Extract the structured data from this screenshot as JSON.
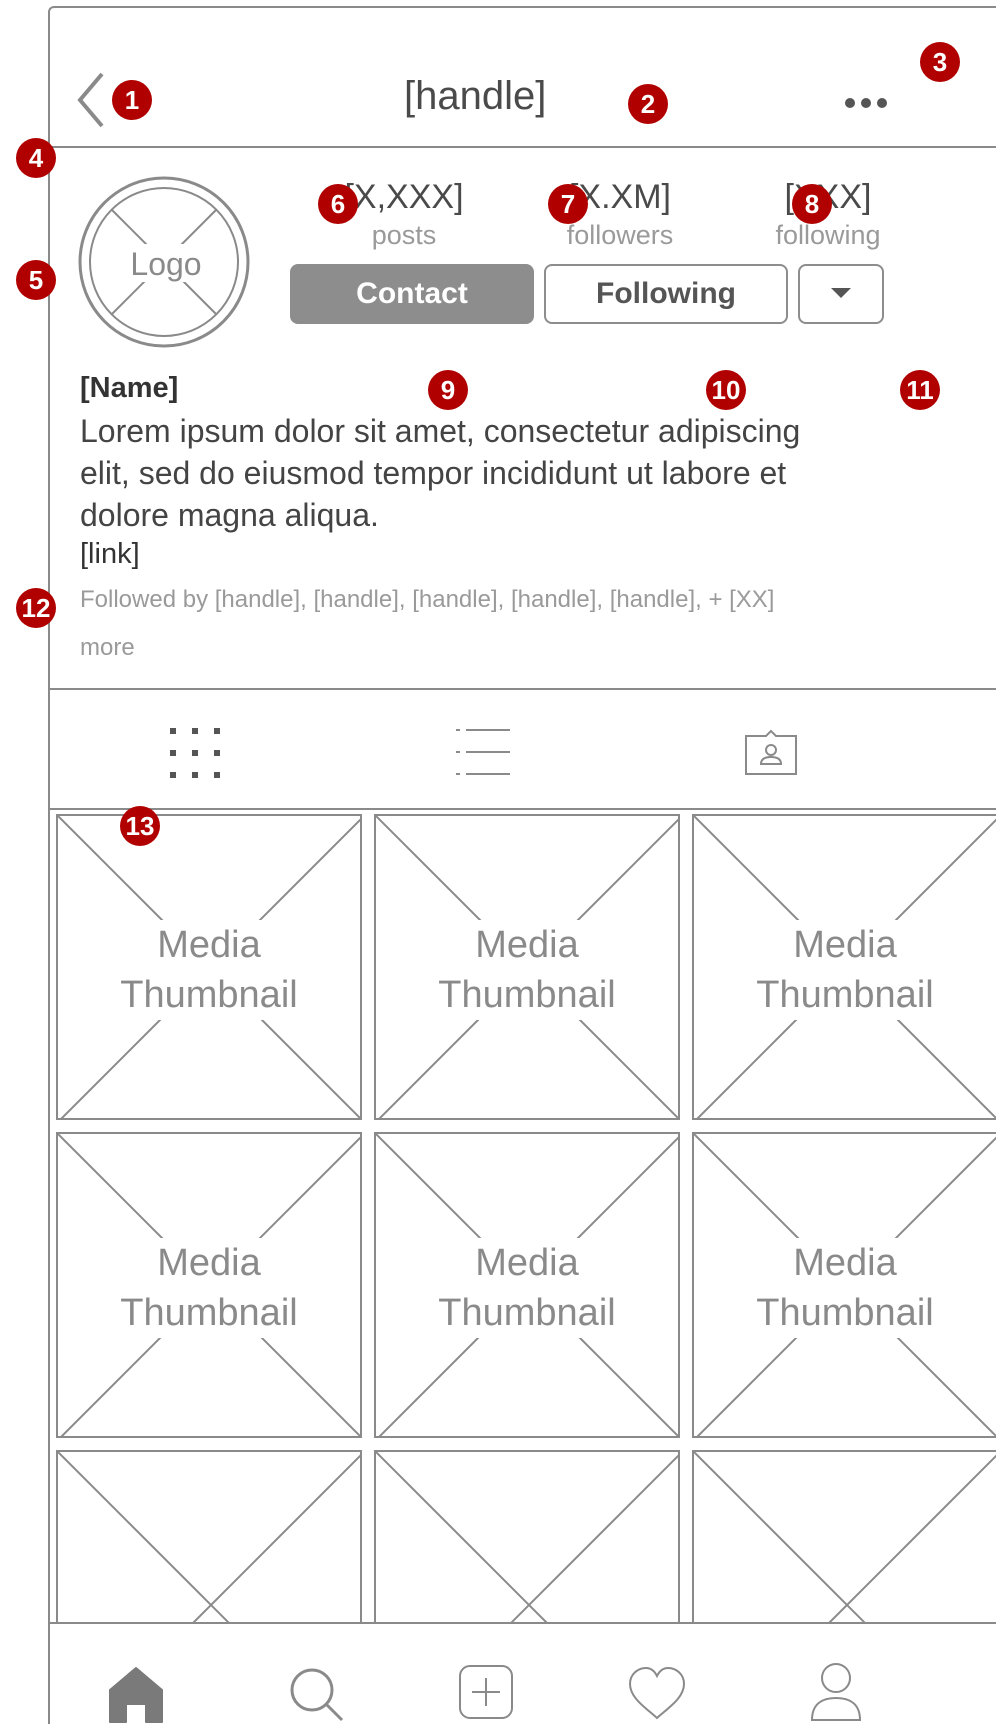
{
  "header": {
    "title": "[handle]"
  },
  "badges": [
    "1",
    "2",
    "3",
    "4",
    "5",
    "6",
    "7",
    "8",
    "9",
    "10",
    "11",
    "12",
    "13"
  ],
  "profile": {
    "logo_label": "Logo",
    "stats": [
      {
        "value": "[X,XXX]",
        "label": "posts"
      },
      {
        "value": "[X.XM]",
        "label": "followers"
      },
      {
        "value": "[XXX]",
        "label": "following"
      }
    ],
    "buttons": {
      "contact": "Contact",
      "following": "Following"
    },
    "name": "[Name]",
    "bio_lines": [
      "Lorem ipsum dolor sit amet, consectetur adipiscing",
      "elit, sed do eiusmod tempor incididunt ut labore et",
      "dolore magna aliqua."
    ],
    "link": "[link]",
    "followed_by_lines": [
      "Followed by [handle], [handle], [handle], [handle], [handle], + [XX]",
      "more"
    ]
  },
  "grid": {
    "thumbnail_line1": "Media",
    "thumbnail_line2": "Thumbnail"
  },
  "icons": {
    "back": "chevron-left-icon",
    "more": "more-dots-icon",
    "dropdown": "caret-down-icon",
    "grid_view": "grid-view-icon",
    "list_view": "list-view-icon",
    "tagged": "tagged-photos-icon",
    "home": "home-icon",
    "search": "search-icon",
    "add": "add-post-icon",
    "activity": "heart-icon",
    "profile": "profile-icon"
  },
  "colors": {
    "annotation_badge": "#b00000",
    "wire_stroke": "#8a8a8a",
    "contact_button": "#8d8d8d"
  }
}
